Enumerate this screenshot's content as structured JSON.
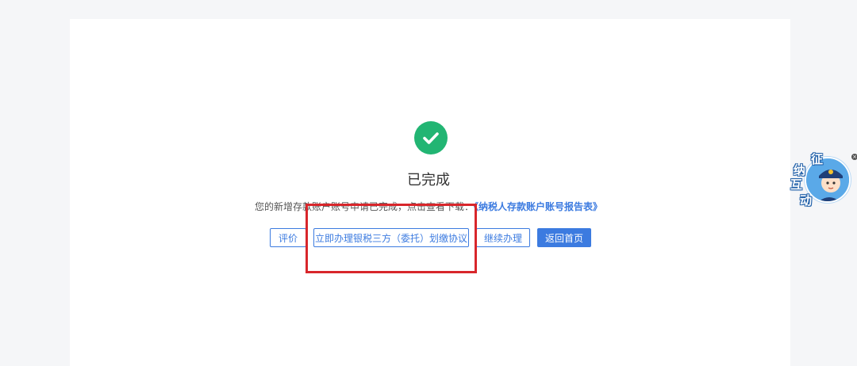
{
  "status": {
    "title": "已完成",
    "message_prefix": "您的新增存款账户账号申请已完成，点击查看下载：",
    "report_link": "《纳税人存款账户账号报告表》"
  },
  "actions": {
    "evaluate": "评价",
    "bank_agreement": "立即办理银税三方（委托）划缴协议",
    "continue": "继续办理",
    "home": "返回首页"
  },
  "float_widget": {
    "chars": [
      "征",
      "纳",
      "互",
      "动"
    ],
    "close": "×"
  },
  "colors": {
    "success": "#22b573",
    "primary": "#3c7be0",
    "annotation": "#d8262b"
  },
  "icons": {
    "success": "check-circle-icon",
    "close": "close-icon"
  }
}
